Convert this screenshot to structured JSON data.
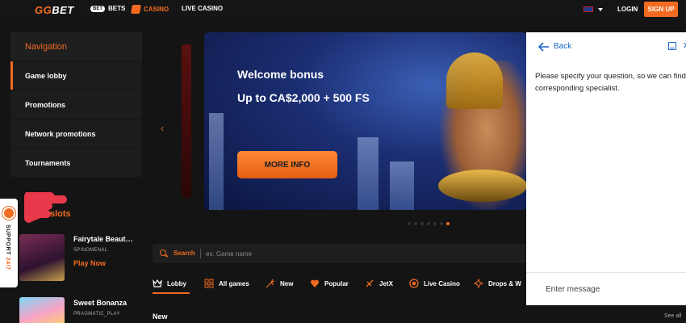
{
  "header": {
    "logo_gg": "GG",
    "logo_bet": "BET",
    "bets_badge": "BET",
    "bets_label": "BETS",
    "casino_label": "CASINO",
    "live_casino_label": "LIVE CASINO",
    "login_label": "LOGIN",
    "signup_label": "SIGN UP"
  },
  "sidebar": {
    "heading": "Navigation",
    "items": [
      {
        "label": "Game lobby"
      },
      {
        "label": "Promotions"
      },
      {
        "label": "Network promotions"
      },
      {
        "label": "Tournaments"
      }
    ]
  },
  "popular": {
    "title": "slots",
    "slots": [
      {
        "name": "Fairytale Beaut…",
        "provider": "SPINOMENAL",
        "action": "Play Now"
      },
      {
        "name": "Sweet Bonanza",
        "provider": "PRAGMATIC_PLAY"
      }
    ]
  },
  "support": {
    "label_prefix": "SUPPORT ",
    "label_suffix": "24/7"
  },
  "banner": {
    "title": "Welcome bonus",
    "subtitle": "Up to CA$2,000 + 500 FS",
    "button_label": "MORE INFO"
  },
  "search": {
    "label": "Search",
    "placeholder": "ex. Game name"
  },
  "tabs": [
    {
      "label": "Lobby",
      "icon": "crown-icon"
    },
    {
      "label": "All games",
      "icon": "grid-icon"
    },
    {
      "label": "New",
      "icon": "sparkle-icon"
    },
    {
      "label": "Popular",
      "icon": "heart-icon"
    },
    {
      "label": "JetX",
      "icon": "jet-icon"
    },
    {
      "label": "Live Casino",
      "icon": "live-icon"
    },
    {
      "label": "Drops & W",
      "icon": "drops-icon"
    }
  ],
  "section": {
    "title": "New",
    "see_all": "See all"
  },
  "chat": {
    "back_label": "Back",
    "message": "Please specify your question, so we can find corresponding specialist.",
    "input_placeholder": "Enter message"
  },
  "colors": {
    "accent": "#f26b21",
    "background": "#141414",
    "link_blue": "#1a66c9"
  }
}
